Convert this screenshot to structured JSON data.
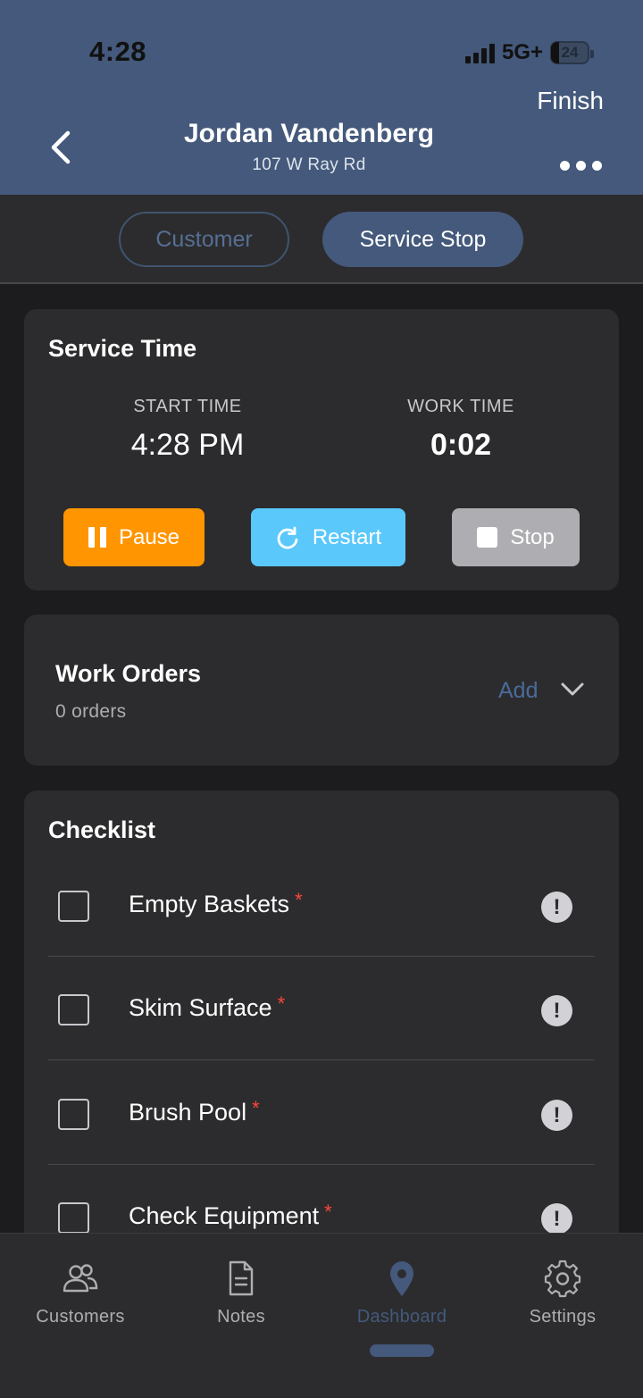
{
  "status_bar": {
    "time": "4:28",
    "network": "5G+",
    "battery": "24"
  },
  "header": {
    "title": "Jordan Vandenberg",
    "subtitle": "107 W Ray Rd",
    "finish_label": "Finish"
  },
  "segments": {
    "customer": "Customer",
    "service_stop": "Service Stop",
    "selected": "service_stop"
  },
  "service_time": {
    "title": "Service Time",
    "start_label": "START TIME",
    "start_value": "4:28 PM",
    "work_label": "WORK TIME",
    "work_value": "0:02",
    "pause_label": "Pause",
    "restart_label": "Restart",
    "stop_label": "Stop"
  },
  "work_orders": {
    "title": "Work Orders",
    "count": "0 orders",
    "add_label": "Add"
  },
  "checklist": {
    "title": "Checklist",
    "items": [
      {
        "label": "Empty Baskets",
        "required": "*"
      },
      {
        "label": "Skim Surface",
        "required": "*"
      },
      {
        "label": "Brush Pool",
        "required": "*"
      },
      {
        "label": "Check Equipment",
        "required": "*"
      }
    ]
  },
  "tabs": [
    {
      "label": "Customers",
      "icon": "people-icon"
    },
    {
      "label": "Notes",
      "icon": "document-icon"
    },
    {
      "label": "Dashboard",
      "icon": "location-pin-icon",
      "active": true
    },
    {
      "label": "Settings",
      "icon": "gear-icon"
    }
  ],
  "colors": {
    "accent": "#44597b",
    "pause": "#ff9500",
    "restart": "#5ac8fa",
    "stop": "#aeaeb2",
    "required": "#ff453a"
  }
}
